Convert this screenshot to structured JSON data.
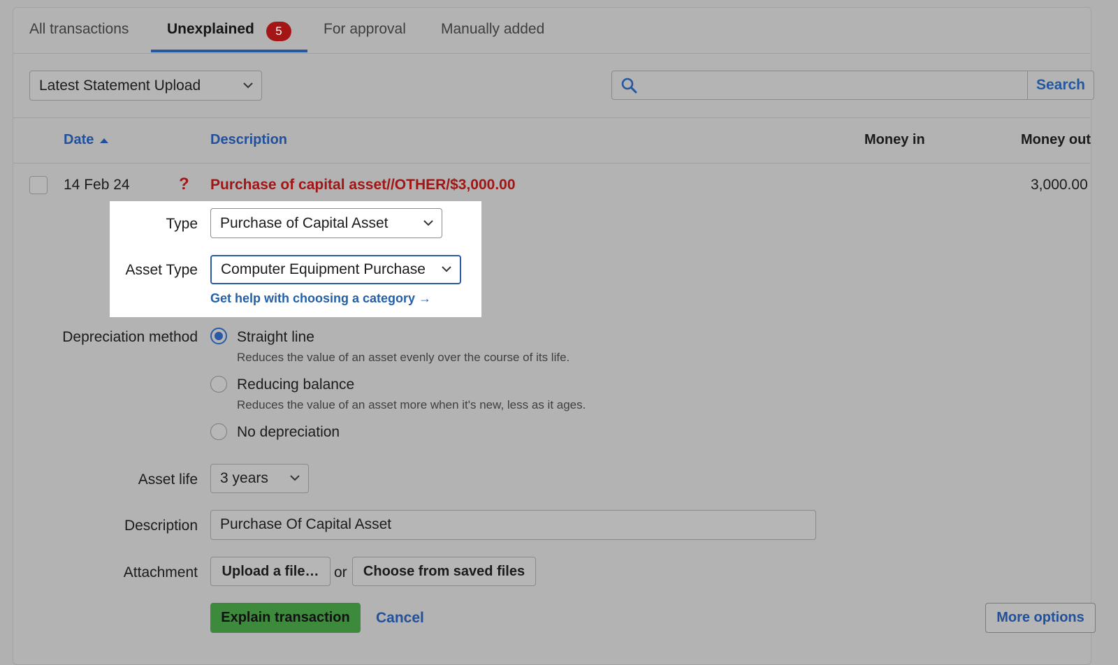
{
  "tabs": [
    {
      "label": "All transactions"
    },
    {
      "label": "Unexplained",
      "badge": "5"
    },
    {
      "label": "For approval"
    },
    {
      "label": "Manually added"
    }
  ],
  "filter": {
    "selected": "Latest Statement Upload"
  },
  "search": {
    "value": "",
    "button_label": "Search"
  },
  "columns": {
    "date": "Date",
    "description": "Description",
    "money_in": "Money in",
    "money_out": "Money out"
  },
  "transaction": {
    "date": "14 Feb 24",
    "status_glyph": "?",
    "description": "Purchase of capital asset//OTHER/$3,000.00",
    "money_out": "3,000.00"
  },
  "form": {
    "type_label": "Type",
    "type_value": "Purchase of Capital Asset",
    "asset_type_label": "Asset Type",
    "asset_type_value": "Computer Equipment Purchase",
    "help_link": "Get help with choosing a category →",
    "depreciation_label": "Depreciation method",
    "depreciation_options": [
      {
        "label": "Straight line",
        "hint": "Reduces the value of an asset evenly over the course of its life.",
        "selected": true
      },
      {
        "label": "Reducing balance",
        "hint": "Reduces the value of an asset more when it's new, less as it ages.",
        "selected": false
      },
      {
        "label": "No depreciation",
        "hint": "",
        "selected": false
      }
    ],
    "asset_life_label": "Asset life",
    "asset_life_value": "3 years",
    "description_label": "Description",
    "description_value": "Purchase Of Capital Asset",
    "attachment_label": "Attachment",
    "upload_label": "Upload a file…",
    "or_text": "or",
    "choose_saved_label": "Choose from saved files"
  },
  "actions": {
    "explain": "Explain transaction",
    "cancel": "Cancel",
    "more_options": "More options"
  },
  "colors": {
    "accent": "#2358a0",
    "badge": "#a41515",
    "alert_text": "#a01616",
    "primary_button": "#3d8a3d"
  }
}
